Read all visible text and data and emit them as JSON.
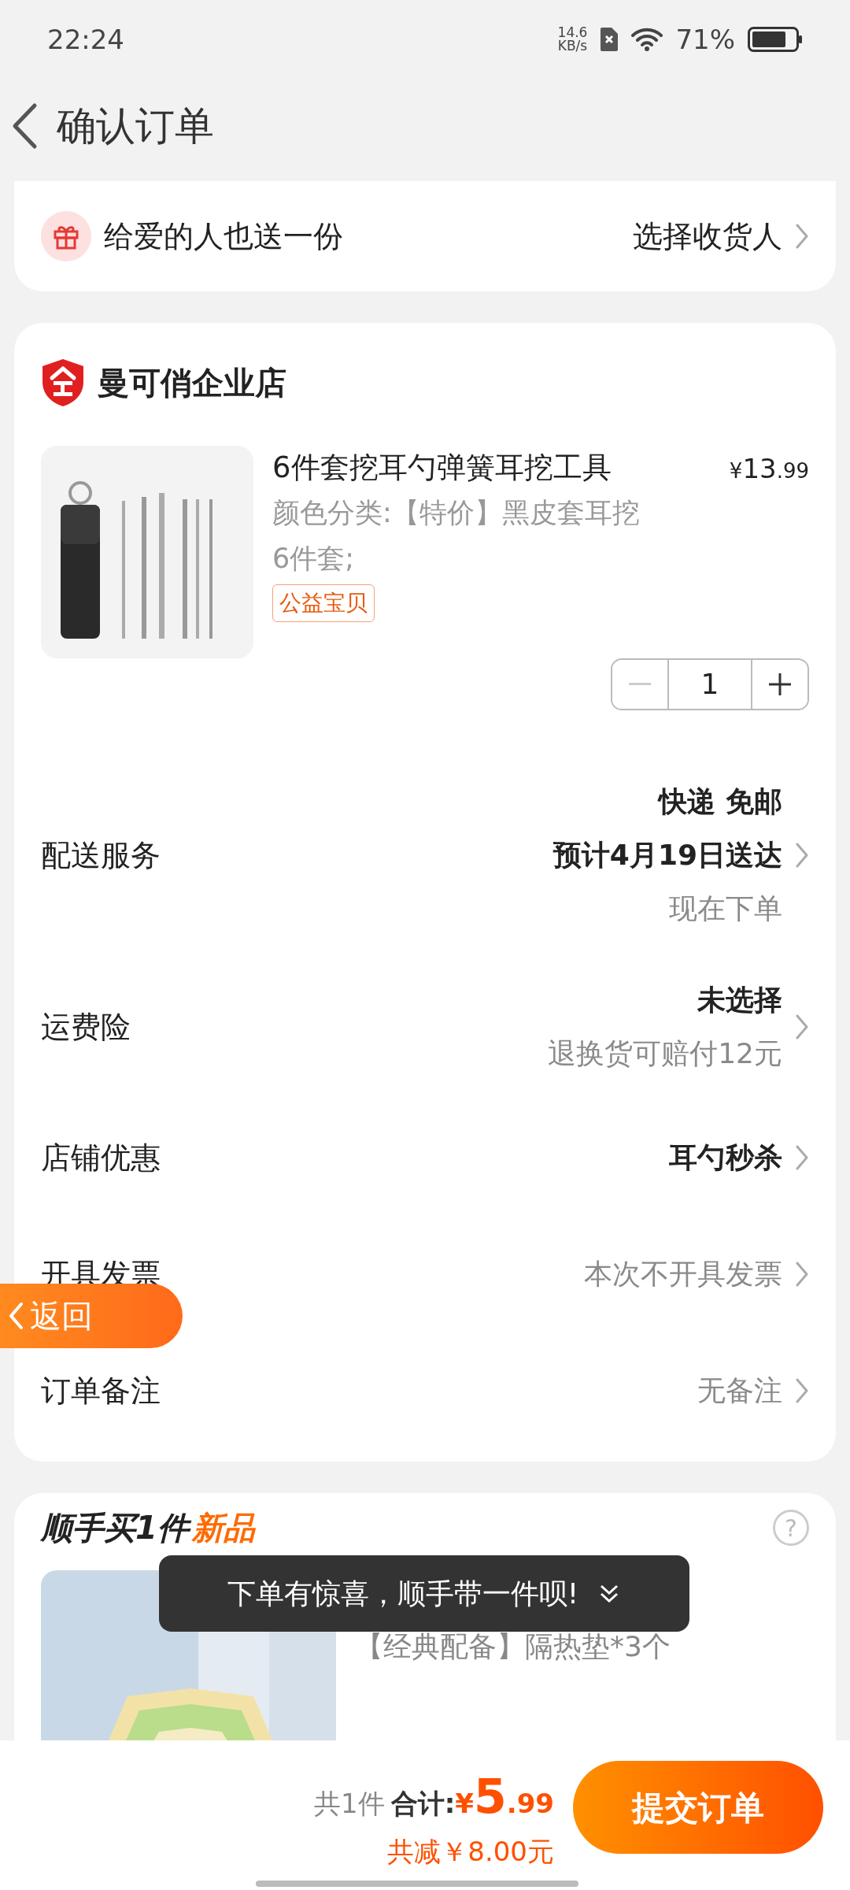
{
  "status_bar": {
    "time": "22:24",
    "net_speed_value": "14.6",
    "net_speed_unit": "KB/s",
    "battery_text": "71%"
  },
  "header": {
    "title": "确认订单"
  },
  "gift_row": {
    "label": "给爱的人也送一份",
    "action": "选择收货人"
  },
  "store": {
    "name": "曼可俏企业店",
    "item": {
      "title": "6件套挖耳勺弹簧耳挖工具",
      "currency": "¥",
      "price_int": "13",
      "price_dec": ".99",
      "spec": "颜色分类:【特价】黑皮套耳挖6件套;",
      "tag": "公益宝贝",
      "quantity": "1",
      "minus_disabled": true
    },
    "rows": [
      {
        "label": "配送服务",
        "lines": [
          {
            "text": "快递 免邮",
            "emphasis": true
          },
          {
            "text": "预计4月19日送达",
            "emphasis": true
          },
          {
            "text": "现在下单",
            "emphasis": false
          }
        ]
      },
      {
        "label": "运费险",
        "lines": [
          {
            "text": "未选择",
            "emphasis": true
          },
          {
            "text": "退换货可赔付12元",
            "emphasis": false
          }
        ]
      },
      {
        "label": "店铺优惠",
        "lines": [
          {
            "text": "耳勺秒杀",
            "emphasis": true
          }
        ]
      },
      {
        "label": "开具发票",
        "lines": [
          {
            "text": "本次不开具发票",
            "emphasis": false
          }
        ]
      },
      {
        "label": "订单备注",
        "lines": [
          {
            "text": "无备注",
            "emphasis": false
          }
        ]
      }
    ]
  },
  "bundle": {
    "title": "顺手买1件",
    "badge": "新品",
    "help": "?",
    "spec": "【经典配备】隔热垫*3个"
  },
  "toast": {
    "text": "下单有惊喜，顺手带一件呗!"
  },
  "back_pill": {
    "label": "返回"
  },
  "bottom_bar": {
    "count": "共1件",
    "total_label": "合计:",
    "currency": "¥",
    "total_int": "5",
    "total_dec": ".99",
    "discount": "共减￥8.00元",
    "submit": "提交订单"
  }
}
